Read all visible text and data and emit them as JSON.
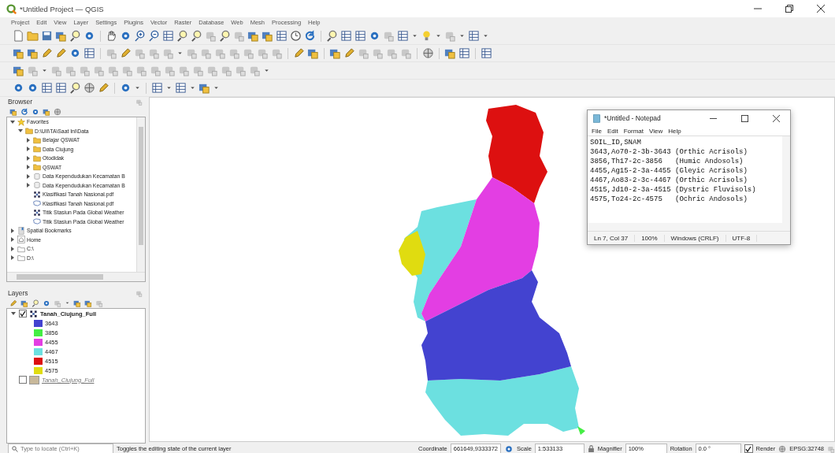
{
  "window": {
    "title": "*Untitled Project — QGIS"
  },
  "menu": [
    "Project",
    "Edit",
    "View",
    "Layer",
    "Settings",
    "Plugins",
    "Vector",
    "Raster",
    "Database",
    "Web",
    "Mesh",
    "Processing",
    "Help"
  ],
  "browser": {
    "title": "Browser",
    "items": [
      {
        "label": "Favorites",
        "kind": "favorites",
        "expanded": true,
        "children": [
          {
            "label": "D:\\UII\\TA\\Saat Ini\\Data",
            "kind": "folder",
            "expanded": true,
            "children": [
              {
                "label": "Belajar QSWAT",
                "kind": "folder",
                "expanded": false
              },
              {
                "label": "Data Ciujung",
                "kind": "folder",
                "expanded": false
              },
              {
                "label": "Otodidak",
                "kind": "folder",
                "expanded": false
              },
              {
                "label": "QSWAT",
                "kind": "folder",
                "expanded": false
              },
              {
                "label": "Data Kependudukan Kecamatan B",
                "kind": "database",
                "expanded": false
              },
              {
                "label": "Data Kependudukan Kecamatan B",
                "kind": "database",
                "expanded": false
              },
              {
                "label": "Klasifikasi Tanah Nasional.pdf",
                "kind": "raster"
              },
              {
                "label": "Klasifikasi Tanah Nasional.pdf",
                "kind": "polygon"
              },
              {
                "label": "Titik Stasiun Pada Global Weather",
                "kind": "raster"
              },
              {
                "label": "Titik Stasiun Pada Global Weather",
                "kind": "polygon"
              }
            ]
          }
        ]
      },
      {
        "label": "Spatial Bookmarks",
        "kind": "bookmarks",
        "expanded": false
      },
      {
        "label": "Home",
        "kind": "home",
        "expanded": false
      },
      {
        "label": "C:\\",
        "kind": "drive",
        "expanded": false
      },
      {
        "label": "D:\\",
        "kind": "drive",
        "expanded": false
      }
    ]
  },
  "layers": {
    "title": "Layers",
    "items": [
      {
        "label": "Tanah_Ciujung_Full",
        "checked": true,
        "expanded": true,
        "unavailable": false,
        "children": [
          {
            "label": "3643",
            "color": "#4343d0"
          },
          {
            "label": "3856",
            "color": "#44ee44"
          },
          {
            "label": "4455",
            "color": "#e33ee3"
          },
          {
            "label": "4467",
            "color": "#6ce0e0"
          },
          {
            "label": "4515",
            "color": "#dd1010"
          },
          {
            "label": "4575",
            "color": "#e0dc10"
          }
        ]
      },
      {
        "label": "Tanah_Ciujung_Full",
        "checked": false,
        "unavailable": true
      }
    ]
  },
  "notepad": {
    "title": "*Untitled - Notepad",
    "menu": [
      "File",
      "Edit",
      "Format",
      "View",
      "Help"
    ],
    "lines": [
      "SOIL_ID,SNAM",
      "3643,Ao70-2-3b-3643 (Orthic Acrisols)",
      "3856,Th17-2c-3856   (Humic Andosols)",
      "4455,Ag15-2-3a-4455 (Gleyic Acrisols)",
      "4467,Ao83-2-3c-4467 (Orthic Acrisols)",
      "4515,Jd10-2-3a-4515 (Dystric Fluvisols)",
      "4575,To24-2c-4575   (Ochric Andosols)"
    ],
    "status": [
      "Ln 7, Col 37",
      "100%",
      "Windows (CRLF)",
      "UTF-8"
    ]
  },
  "status_bar": {
    "locate_placeholder": "Type to locate (Ctrl+K)",
    "message": "Toggles the editing state of the current layer",
    "coordinate": {
      "label": "Coordinate",
      "value": "661649,9333372"
    },
    "scale": {
      "label": "Scale",
      "value": "1:533133"
    },
    "magnifier": {
      "label": "Magnifier",
      "value": "100%"
    },
    "rotation": {
      "label": "Rotation",
      "value": "0.0 °"
    },
    "render": {
      "label": "Render",
      "checked": true
    },
    "crs": "EPSG:32748"
  }
}
